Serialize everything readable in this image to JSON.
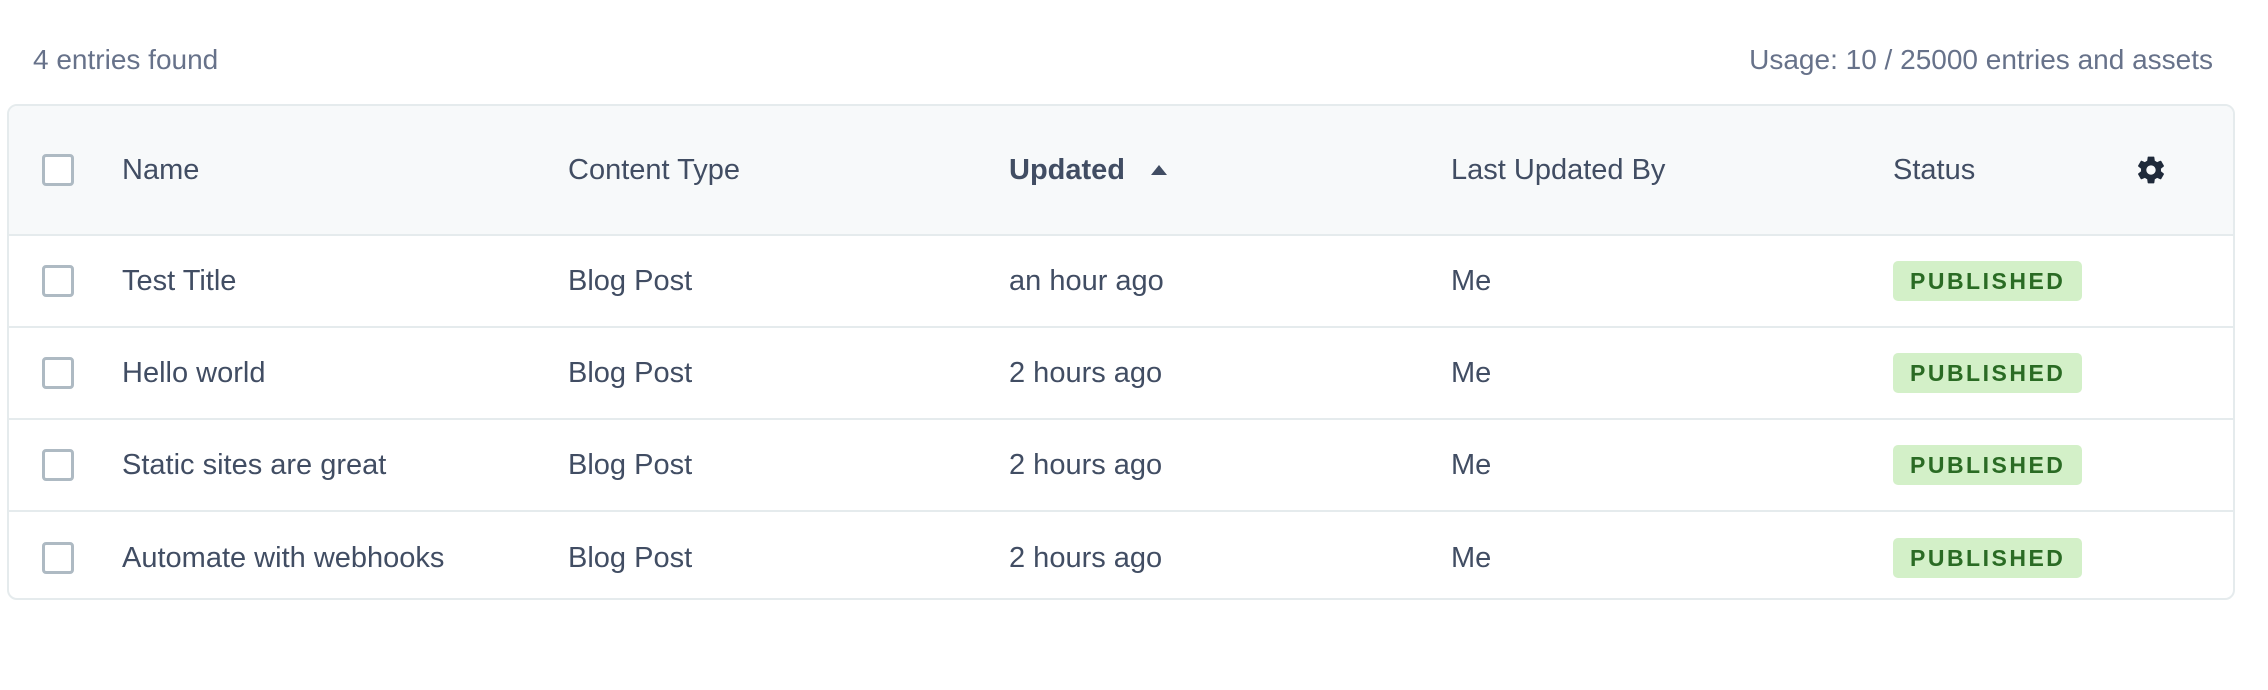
{
  "summary": {
    "entries_found": "4 entries found",
    "usage": "Usage: 10 / 25000 entries and assets"
  },
  "table": {
    "columns": {
      "name": "Name",
      "content_type": "Content Type",
      "updated": "Updated",
      "last_updated_by": "Last Updated By",
      "status": "Status"
    },
    "sort": {
      "column": "updated",
      "direction": "ascending",
      "icon": "caret-up-icon"
    },
    "settings_icon": "gear-icon",
    "rows": [
      {
        "name": "Test Title",
        "content_type": "Blog Post",
        "updated": "an hour ago",
        "last_updated_by": "Me",
        "status": "PUBLISHED"
      },
      {
        "name": "Hello world",
        "content_type": "Blog Post",
        "updated": "2 hours ago",
        "last_updated_by": "Me",
        "status": "PUBLISHED"
      },
      {
        "name": "Static sites are great",
        "content_type": "Blog Post",
        "updated": "2 hours ago",
        "last_updated_by": "Me",
        "status": "PUBLISHED"
      },
      {
        "name": "Automate with webhooks",
        "content_type": "Blog Post",
        "updated": "2 hours ago",
        "last_updated_by": "Me",
        "status": "PUBLISHED"
      }
    ]
  },
  "colors": {
    "published_badge_bg": "#d3f0c8",
    "published_badge_text": "#2a6b24",
    "header_bg": "#f7f9fa",
    "border": "#e5ebed",
    "text": "#414d63",
    "muted_text": "#67728a"
  }
}
